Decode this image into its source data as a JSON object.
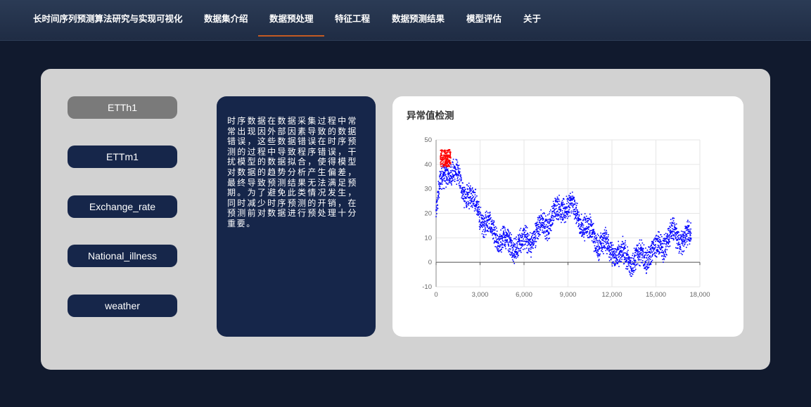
{
  "nav": {
    "brand": "长时间序列预测算法研究与实现可视化",
    "items": [
      {
        "label": "数据集介绍"
      },
      {
        "label": "数据预处理"
      },
      {
        "label": "特征工程"
      },
      {
        "label": "数据预测结果"
      },
      {
        "label": "模型评估"
      },
      {
        "label": "关于"
      }
    ],
    "active_index": 1,
    "underline_color": "#c45a22"
  },
  "datasets": [
    "ETTh1",
    "ETTm1",
    "Exchange_rate",
    "National_illness",
    "weather"
  ],
  "active_dataset": "ETTh1",
  "description": "时序数据在数据采集过程中常常出现因外部因素导致的数据错误，这些数据错误在时序预测的过程中导致程序错误，干扰模型的数据拟合，使得模型对数据的趋势分析产生偏差，最终导致预测结果无法满足预期。为了避免此类情况发生，同时减少时序预测的开销，在预测前对数据进行预处理十分重要。",
  "chart": {
    "title": "异常值检测"
  },
  "chart_data": {
    "type": "scatter",
    "title": "异常值检测",
    "xlim": [
      0,
      18000
    ],
    "ylim": [
      -10,
      50
    ],
    "x_ticks": [
      "0",
      "3,000",
      "6,000",
      "9,000",
      "12,000",
      "15,000",
      "18,000"
    ],
    "y_ticks": [
      "-10",
      "0",
      "10",
      "20",
      "30",
      "40",
      "50"
    ],
    "grid": true,
    "series": [
      {
        "color": "#0000ff",
        "trend": {
          "x": [
            0,
            300,
            600,
            800,
            1200,
            1600,
            2000,
            2500,
            3000,
            3500,
            4000,
            4500,
            5000,
            5500,
            6000,
            6500,
            7000,
            7500,
            8000,
            8500,
            9000,
            9500,
            10000,
            10500,
            11000,
            11500,
            12000,
            12500,
            13000,
            13500,
            14000,
            14500,
            15000,
            15500,
            16000,
            16500,
            17000,
            17400
          ],
          "y": [
            20,
            32,
            36,
            38,
            36,
            33,
            29,
            25,
            20,
            15,
            11,
            9,
            8,
            7,
            8,
            10,
            13,
            16,
            19,
            22,
            24,
            20,
            16,
            12,
            9,
            7,
            5,
            3,
            2,
            1,
            2,
            3,
            5,
            8,
            10,
            11,
            10,
            9
          ]
        },
        "spread": 3.5
      },
      {
        "color": "#ff0000",
        "x_range": [
          300,
          1000
        ],
        "y_range": [
          39,
          46
        ]
      }
    ]
  }
}
